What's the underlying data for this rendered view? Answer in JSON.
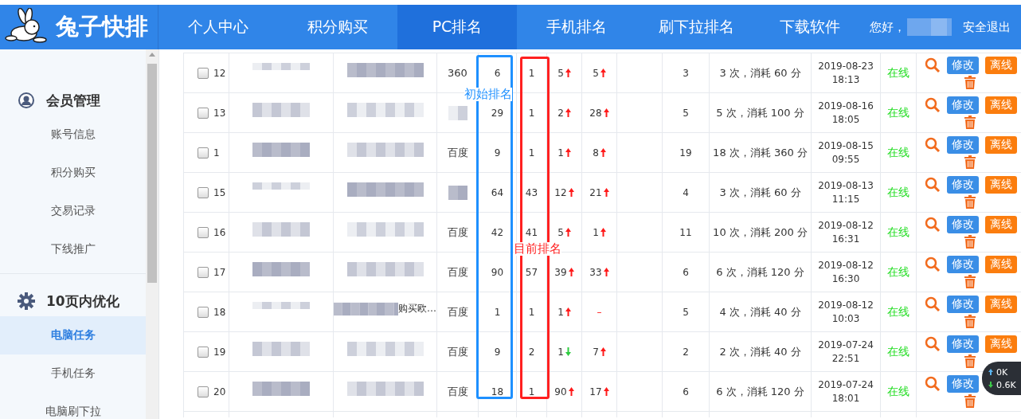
{
  "header": {
    "logo": "兔子快排",
    "nav": [
      {
        "label": "个人中心",
        "selected": false
      },
      {
        "label": "积分购买",
        "selected": false
      },
      {
        "label": "PC排名",
        "selected": true
      },
      {
        "label": "手机排名",
        "selected": false
      },
      {
        "label": "刷下拉排名",
        "selected": false
      },
      {
        "label": "下载软件",
        "selected": false
      }
    ],
    "greeting": "您好，",
    "logout": "安全退出"
  },
  "sidebar": {
    "sections": [
      {
        "kind": "user",
        "title": "会员管理",
        "items": [
          {
            "label": "账号信息",
            "selected": false
          },
          {
            "label": "积分购买",
            "selected": false
          },
          {
            "label": "交易记录",
            "selected": false
          },
          {
            "label": "下线推广",
            "selected": false
          }
        ]
      },
      {
        "kind": "gear",
        "title": "10页内优化",
        "items": [
          {
            "label": "电脑任务",
            "selected": true
          },
          {
            "label": "手机任务",
            "selected": false
          },
          {
            "label": "电脑刷下拉",
            "selected": false
          }
        ]
      }
    ]
  },
  "table": {
    "rows": [
      {
        "checked": false,
        "id": "12",
        "engine": "360",
        "initial": "6",
        "current": "1",
        "change_1": {
          "text": "5",
          "kind": "up"
        },
        "change_2": {
          "text": "5",
          "kind": "up"
        },
        "count": "3",
        "cost": "3 次，消耗 60 分",
        "date": "2019-08-23",
        "time": "18:13",
        "status": "在线",
        "edit": "修改",
        "offline": "离线"
      },
      {
        "checked": false,
        "id": "13",
        "initial": "29",
        "current": "1",
        "change_1": {
          "text": "2",
          "kind": "up"
        },
        "change_2": {
          "text": "28",
          "kind": "up"
        },
        "count": "5",
        "cost": "5 次，消耗 100 分",
        "date": "2019-08-16",
        "time": "18:05",
        "status": "在线",
        "edit": "修改",
        "offline": "离线"
      },
      {
        "checked": false,
        "id": "1",
        "engine": "百度",
        "initial": "9",
        "current": "1",
        "change_1": {
          "text": "1",
          "kind": "up"
        },
        "change_2": {
          "text": "8",
          "kind": "up"
        },
        "count": "19",
        "cost": "18 次，消耗 360 分",
        "date": "2019-08-15",
        "time": "09:55",
        "status": "在线",
        "edit": "修改",
        "offline": "离线"
      },
      {
        "checked": false,
        "id": "15",
        "initial": "64",
        "current": "43",
        "change_1": {
          "text": "12",
          "kind": "up"
        },
        "change_2": {
          "text": "21",
          "kind": "up"
        },
        "count": "4",
        "cost": "3 次，消耗 60 分",
        "date": "2019-08-13",
        "time": "11:15",
        "status": "在线",
        "edit": "修改",
        "offline": "离线"
      },
      {
        "checked": false,
        "id": "16",
        "engine": "百度",
        "initial": "42",
        "current": "41",
        "change_1": {
          "text": "5",
          "kind": "up"
        },
        "change_2": {
          "text": "1",
          "kind": "up"
        },
        "count": "11",
        "cost": "10 次，消耗 200 分",
        "date": "2019-08-12",
        "time": "16:31",
        "status": "在线",
        "edit": "修改",
        "offline": "离线"
      },
      {
        "checked": false,
        "id": "17",
        "engine": "百度",
        "initial": "90",
        "current": "57",
        "change_1": {
          "text": "39",
          "kind": "up"
        },
        "change_2": {
          "text": "33",
          "kind": "up"
        },
        "count": "6",
        "cost": "6 次，消耗 120 分",
        "date": "2019-08-12",
        "time": "16:30",
        "status": "在线",
        "edit": "修改",
        "offline": "离线"
      },
      {
        "checked": false,
        "id": "18",
        "url_text": "购买欧…",
        "engine": "百度",
        "initial": "1",
        "current": "1",
        "change_1": {
          "text": "1",
          "kind": "up"
        },
        "change_2": {
          "text": "–",
          "kind": "none"
        },
        "count": "5",
        "cost": "4 次，消耗 40 分",
        "date": "2019-08-12",
        "time": "10:03",
        "status": "在线",
        "edit": "修改",
        "offline": "离线"
      },
      {
        "checked": false,
        "id": "19",
        "engine": "百度",
        "initial": "9",
        "current": "2",
        "change_1": {
          "text": "1",
          "kind": "down"
        },
        "change_2": {
          "text": "7",
          "kind": "up"
        },
        "count": "2",
        "cost": "2 次，消耗 40 分",
        "date": "2019-07-24",
        "time": "22:51",
        "status": "在线",
        "edit": "修改",
        "offline": "离线"
      },
      {
        "checked": false,
        "id": "20",
        "engine": "百度",
        "initial": "18",
        "current": "1",
        "change_1": {
          "text": "90",
          "kind": "up"
        },
        "change_2": {
          "text": "17",
          "kind": "up"
        },
        "count": "6",
        "cost": "6 次，消耗 120 分",
        "date": "2019-07-24",
        "time": "18:01",
        "status": "在线",
        "edit": "修改"
      }
    ]
  },
  "annotations": [
    {
      "text": "初始排名",
      "color": "#1e90ff"
    },
    {
      "text": "目前排名",
      "color": "#ff2020"
    }
  ],
  "speed_widget": {
    "up": "0K",
    "down": "0.6K"
  }
}
